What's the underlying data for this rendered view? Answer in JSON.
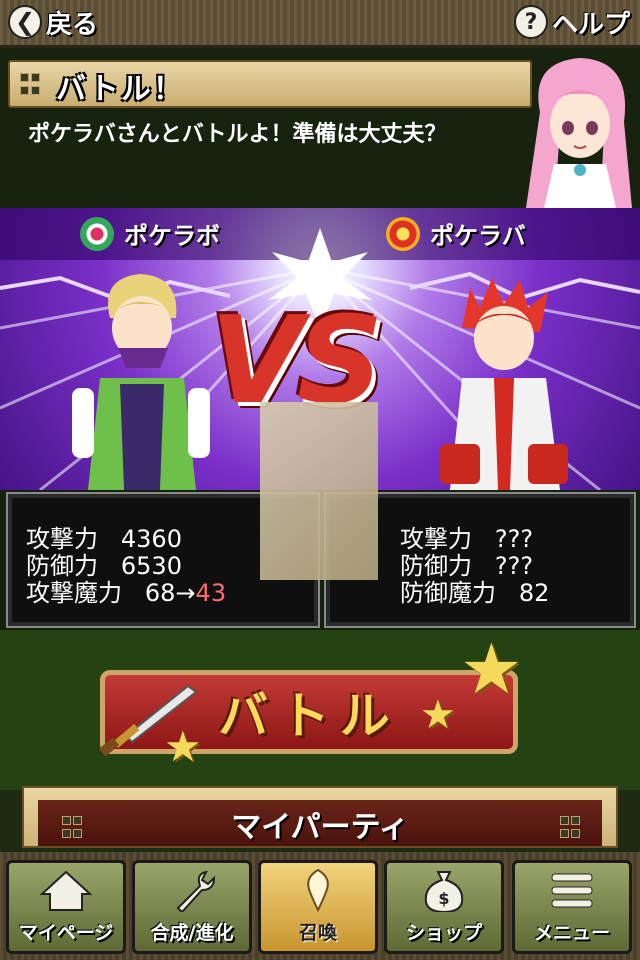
{
  "header": {
    "back_label": "戻る",
    "help_label": "ヘルプ"
  },
  "message": {
    "title": "バトル！",
    "text": "ポケラバさんとバトルよ！準備は大丈夫？"
  },
  "versus": {
    "player_name": "ポケラボ",
    "opponent_name": "ポケラバ",
    "vs_text": "VS"
  },
  "player_stats": {
    "attack_label": "攻撃力",
    "attack": "4360",
    "defense_label": "防御力",
    "defense": "6530",
    "magic_label": "攻撃魔力",
    "magic_before": "68→",
    "magic_after": "43"
  },
  "opponent_stats": {
    "attack_label": "攻撃力",
    "attack": "???",
    "defense_label": "防御力",
    "defense": "???",
    "magic_label": "防御魔力",
    "magic": "82"
  },
  "battle_button": {
    "label": "バトル"
  },
  "party_button": {
    "label": "マイパーティ"
  },
  "nav": {
    "items": [
      {
        "label": "マイページ"
      },
      {
        "label": "合成/進化"
      },
      {
        "label": "召喚"
      },
      {
        "label": "ショップ"
      },
      {
        "label": "メニュー"
      }
    ]
  },
  "colors": {
    "highlight_value": "#ff6b6b",
    "accent": "#d8342a"
  }
}
